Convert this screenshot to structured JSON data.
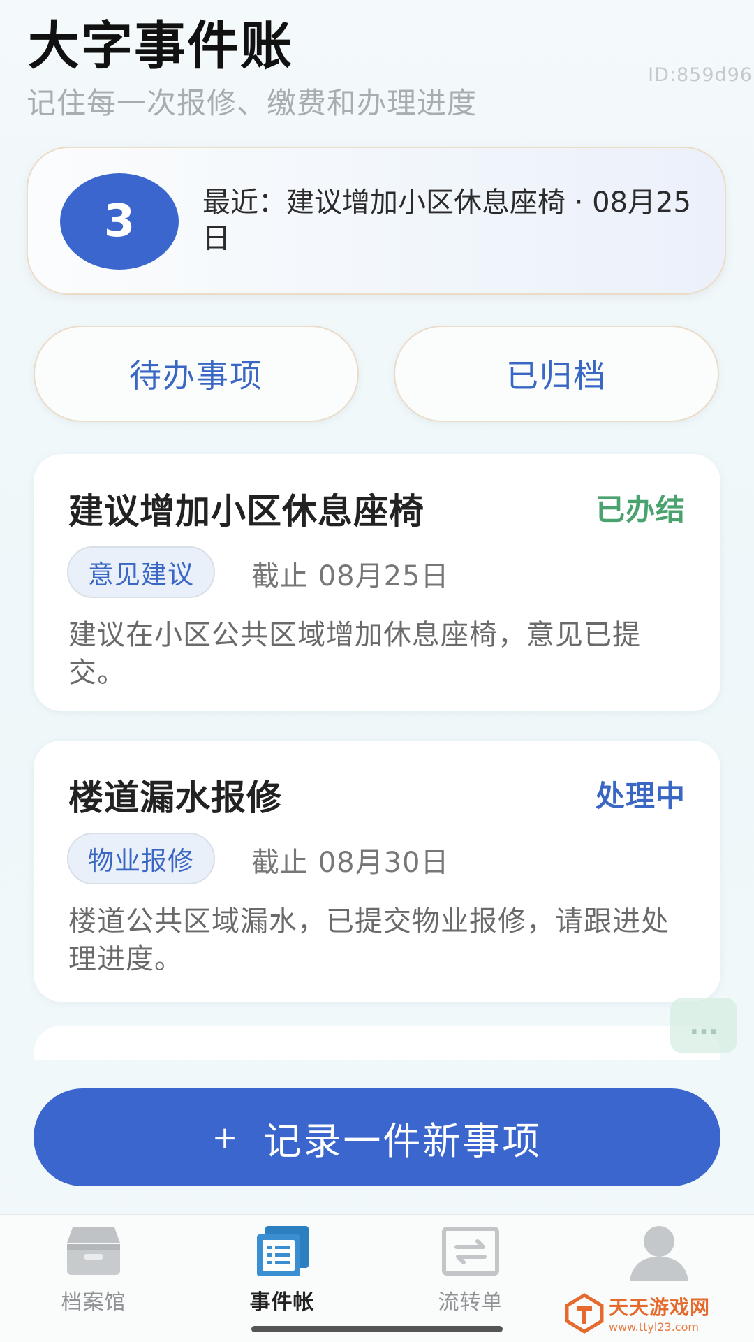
{
  "header": {
    "title": "大字事件账",
    "subtitle": "记住每一次报修、缴费和办理进度",
    "id_text": "ID:859d96"
  },
  "summary": {
    "count": "3",
    "recent_line": "最近：建议增加小区休息座椅 · 08月25日"
  },
  "tabs": [
    {
      "label": "待办事项"
    },
    {
      "label": "已归档"
    }
  ],
  "events": [
    {
      "title": "建议增加小区休息座椅",
      "status": "已办结",
      "status_color": "#4aa36f",
      "tag": "意见建议",
      "deadline": "截止 08月25日",
      "description": "建议在小区公共区域增加休息座椅，意见已提交。"
    },
    {
      "title": "楼道漏水报修",
      "status": "处理中",
      "status_color": "#3a67c4",
      "tag": "物业报修",
      "deadline": "截止 08月30日",
      "description": "楼道公共区域漏水，已提交物业报修，请跟进处理进度。"
    }
  ],
  "float_button": {
    "icon": "more-dots-icon",
    "label": "..."
  },
  "primary_action": {
    "icon": "plus-icon",
    "plus": "+",
    "label": "记录一件新事项"
  },
  "bottom_nav": [
    {
      "label": "档案馆",
      "icon": "archive-box-icon"
    },
    {
      "label": "事件帐",
      "icon": "ledger-icon",
      "active": true
    },
    {
      "label": "流转单",
      "icon": "transfer-arrows-icon"
    },
    {
      "label": "",
      "icon": "user-avatar-icon"
    }
  ],
  "watermark": {
    "main": "天天游戏网",
    "sub": "www.ttyl23.com"
  },
  "colors": {
    "accent": "#3a66cd",
    "done": "#4aa36f",
    "processing": "#3a67c4"
  }
}
